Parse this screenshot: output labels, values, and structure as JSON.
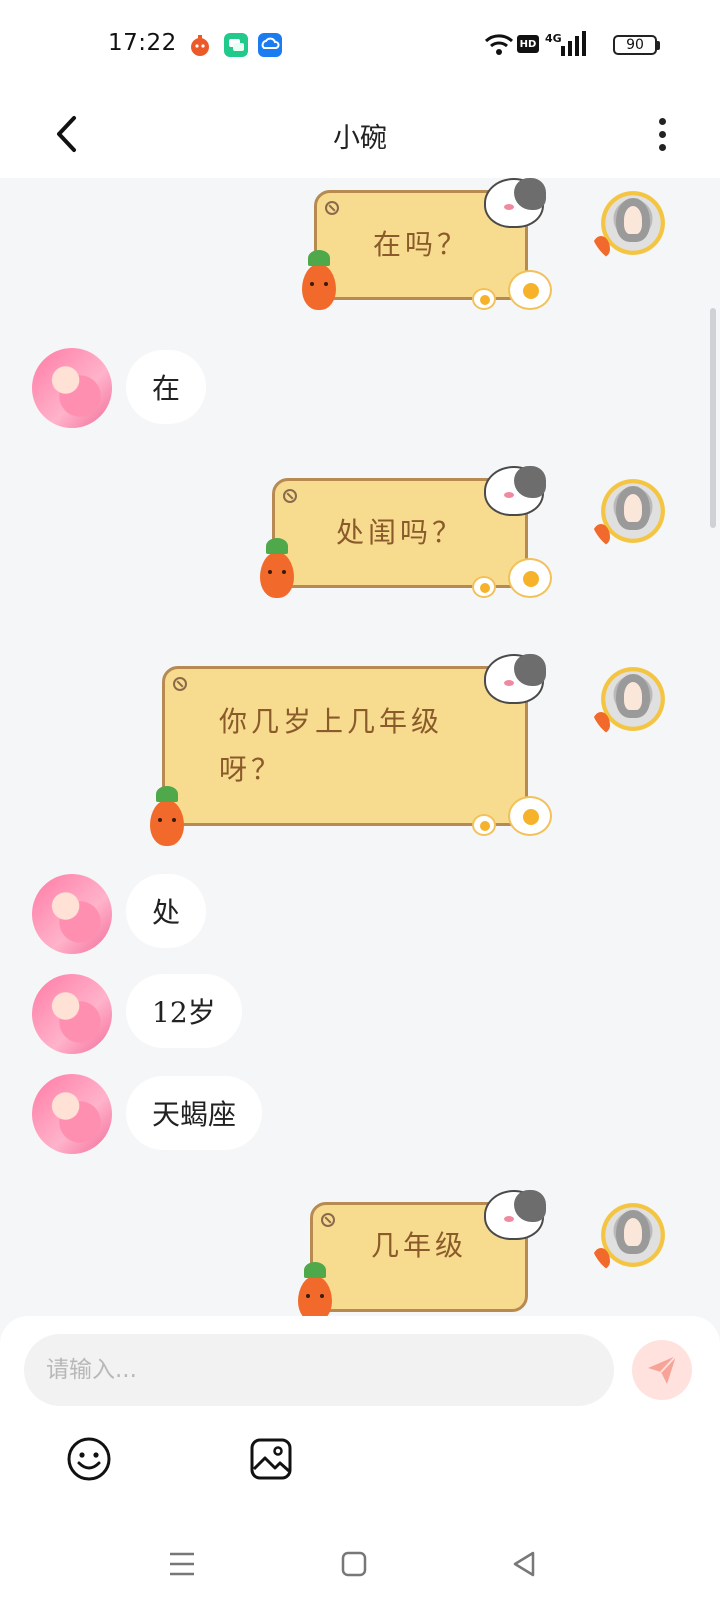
{
  "status_bar": {
    "time": "17:22",
    "network_badge": "HD",
    "network_type": "4G",
    "battery": "90"
  },
  "header": {
    "title": "小碗",
    "back_icon": "chevron-left-icon",
    "more_icon": "more-vertical-icon"
  },
  "messages": [
    {
      "side": "right",
      "style": "sticker-bubble",
      "text": "在吗？"
    },
    {
      "side": "left",
      "style": "plain",
      "text": "在"
    },
    {
      "side": "right",
      "style": "sticker-bubble",
      "text": "处闺吗？"
    },
    {
      "side": "right",
      "style": "sticker-bubble",
      "text": "你几岁上几年级呀？"
    },
    {
      "side": "left",
      "style": "plain",
      "text": "处"
    },
    {
      "side": "left",
      "style": "plain",
      "text": "12岁"
    },
    {
      "side": "left",
      "style": "plain",
      "text": "天蝎座"
    },
    {
      "side": "right",
      "style": "sticker-bubble",
      "text": "几年级"
    }
  ],
  "composer": {
    "placeholder": "请输入...",
    "send_icon": "send-icon",
    "emoji_icon": "emoji-icon",
    "image_icon": "image-icon"
  },
  "colors": {
    "bubble_yellow": "#f7dc90",
    "bubble_text_brown": "#8a5a2b",
    "send_button_bg": "#ffe2dd",
    "send_icon": "#f7a398"
  }
}
